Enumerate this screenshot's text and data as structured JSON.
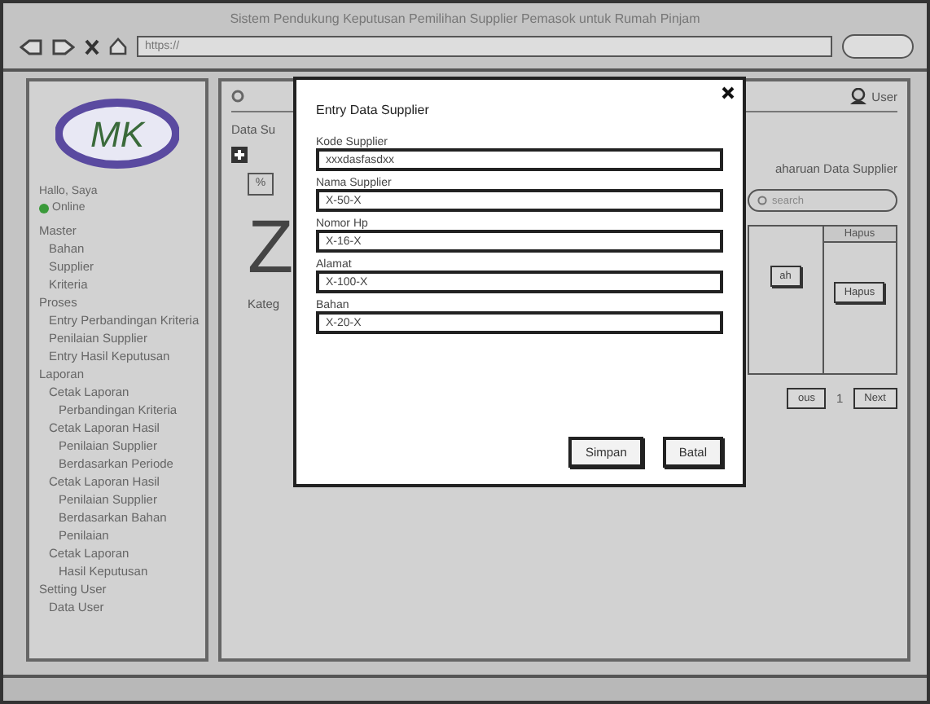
{
  "window": {
    "title": "Sistem Pendukung Keputusan Pemilihan Supplier Pemasok untuk Rumah Pinjam"
  },
  "toolbar": {
    "url": "https://"
  },
  "sidebar": {
    "logo": "MK",
    "greeting": "Hallo, Saya",
    "status": "Online",
    "items": [
      {
        "label": "Master",
        "children": [
          {
            "label": "Bahan"
          },
          {
            "label": "Supplier"
          },
          {
            "label": "Kriteria"
          }
        ]
      },
      {
        "label": "Proses",
        "children": [
          {
            "label": "Entry Perbandingan Kriteria"
          },
          {
            "label": "Penilaian Supplier"
          },
          {
            "label": "Entry Hasil Keputusan"
          }
        ]
      },
      {
        "label": "Laporan",
        "children": [
          {
            "label": "Cetak Laporan",
            "children": [
              {
                "label": "Perbandingan Kriteria"
              }
            ]
          },
          {
            "label": "Cetak Laporan Hasil",
            "children": [
              {
                "label": "Penilaian Supplier"
              },
              {
                "label": "Berdasarkan Periode"
              }
            ]
          },
          {
            "label": "Cetak Laporan Hasil",
            "children": [
              {
                "label": "Penilaian Supplier"
              },
              {
                "label": "Berdasarkan Bahan"
              },
              {
                "label": "Penilaian"
              }
            ]
          },
          {
            "label": "Cetak Laporan",
            "children": [
              {
                "label": "Hasil Keputusan"
              }
            ]
          }
        ]
      },
      {
        "label": "Setting User",
        "children": [
          {
            "label": "Data User"
          }
        ]
      }
    ]
  },
  "main": {
    "user": "User",
    "title": "Data Su",
    "subtitle": "aharuan Data Supplier",
    "tab": "%",
    "big_letter": "Z",
    "left_caption": "Kateg",
    "search": {
      "placeholder": "search"
    },
    "column": "Hapus",
    "row_buttons": [
      "ah",
      "Hapus"
    ],
    "pagination": [
      "ous",
      "1",
      "Next"
    ]
  },
  "dialog": {
    "title": "Entry Data Supplier",
    "fields": [
      {
        "label": "Kode Supplier",
        "value": "xxxdasfasdxx"
      },
      {
        "label": "Nama Supplier",
        "value": "X-50-X"
      },
      {
        "label": "Nomor Hp",
        "value": "X-16-X"
      },
      {
        "label": "Alamat",
        "value": "X-100-X"
      },
      {
        "label": "Bahan",
        "value": "X-20-X"
      }
    ],
    "buttons": [
      "Simpan",
      "Batal"
    ]
  }
}
